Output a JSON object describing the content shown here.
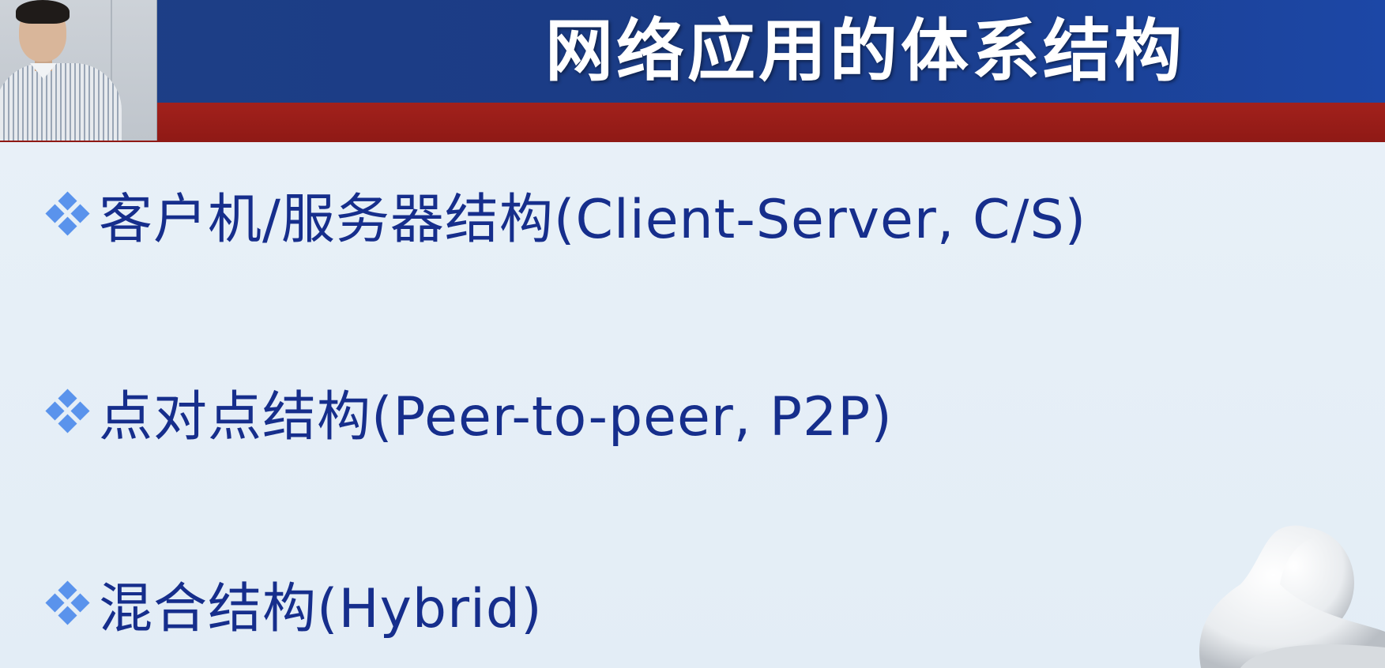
{
  "slide": {
    "title": "网络应用的体系结构",
    "bullets": [
      {
        "text": "客户机/服务器结构(Client-Server, C/S)"
      },
      {
        "text": "点对点结构(Peer-to-peer, P2P)"
      },
      {
        "text": "混合结构(Hybrid)"
      }
    ]
  },
  "colors": {
    "header_blue": "#1e3f87",
    "header_red": "#a2211c",
    "title_text": "#ffffff",
    "bullet_text": "#162e8c",
    "bullet_icon": "#4a86e8",
    "background": "#e6eff7"
  },
  "icons": {
    "bullet": "diamond-cluster-icon",
    "presenter": "presenter-video-thumbnail",
    "decoration": "thinking-figure-icon"
  }
}
